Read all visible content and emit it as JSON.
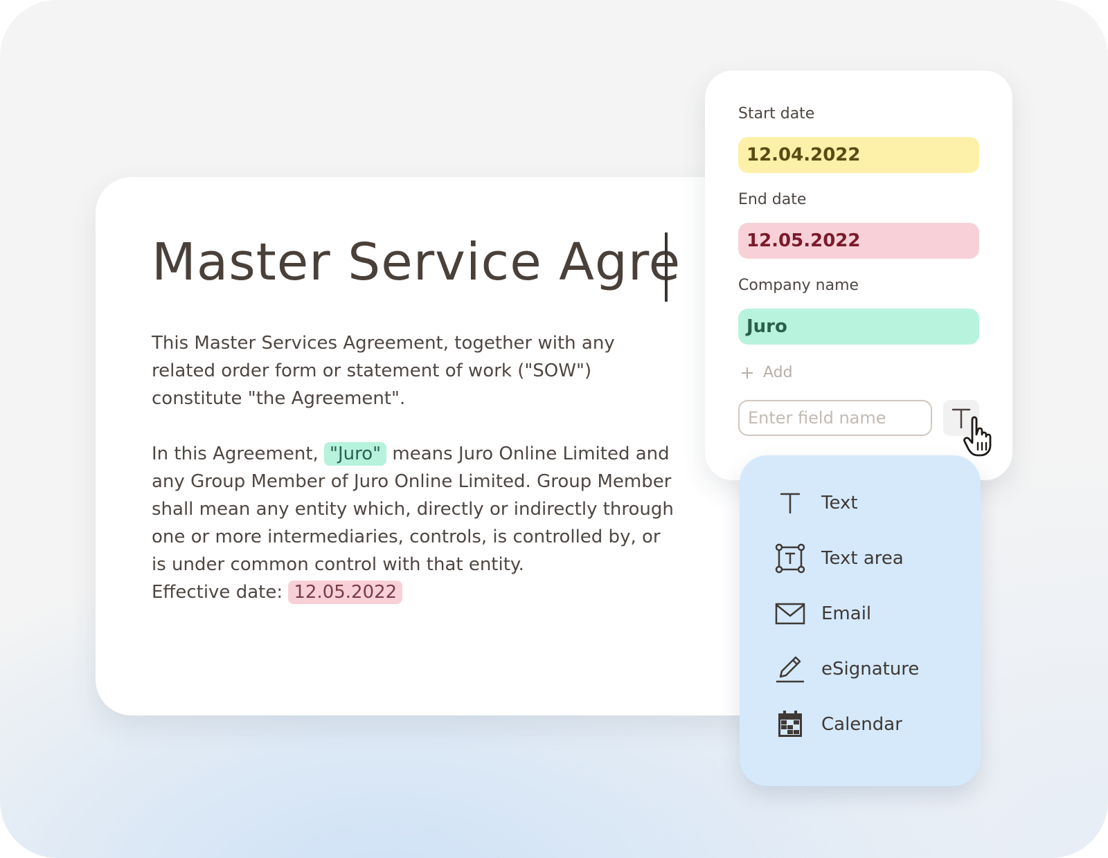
{
  "document": {
    "title": "Master Service Agre",
    "paragraph1": "This  Master Services  Agreement,  together with any related order form or statement of work (\"SOW\") constitute \"the Agreement\".",
    "paragraph2_before": "In this Agreement, ",
    "paragraph2_highlight": "\"Juro\"",
    "paragraph2_after": " means Juro Online Limited and any Group Member of Juro Online Limited. Group Member shall mean any entity which, directly or indirectly through one or more intermediaries, controls, is controlled by, or is under common control with that entity.",
    "effective_label": "Effective date: ",
    "effective_value": "12.05.2022"
  },
  "fields_panel": {
    "start_date": {
      "label": "Start date",
      "value": "12.04.2022"
    },
    "end_date": {
      "label": "End date",
      "value": "12.05.2022"
    },
    "company_name": {
      "label": "Company name",
      "value": "Juro"
    },
    "add_label": "Add",
    "new_field_placeholder": "Enter field name",
    "type_button_glyph": "T"
  },
  "type_menu": {
    "items": [
      {
        "label": "Text",
        "icon": "text-icon"
      },
      {
        "label": "Text area",
        "icon": "text-area-icon"
      },
      {
        "label": "Email",
        "icon": "envelope-icon"
      },
      {
        "label": "eSignature",
        "icon": "pen-icon"
      },
      {
        "label": "Calendar",
        "icon": "calendar-icon"
      }
    ]
  },
  "colors": {
    "yellow_field": "#fdf0a8",
    "red_field": "#f8d1d8",
    "green_field": "#b8f3dd",
    "menu_background": "#d5e9fb"
  }
}
